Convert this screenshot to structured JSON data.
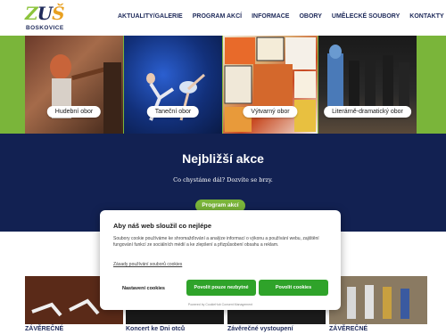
{
  "header": {
    "logo_text": "ZUŠ",
    "logo_city": "BOSKOVICE",
    "nav": [
      "AKTUALITY/GALERIE",
      "PROGRAM AKCÍ",
      "INFORMACE",
      "OBORY",
      "UMĚLECKÉ SOUBORY",
      "KONTAKTY"
    ]
  },
  "hero": {
    "tiles": [
      {
        "label": "Hudební obor"
      },
      {
        "label": "Taneční obor"
      },
      {
        "label": "Výtvarný obor"
      },
      {
        "label": "Literárně-dramatický obor"
      }
    ]
  },
  "events": {
    "title": "Nejbližší akce",
    "subtitle": "Co chystáme dál? Dozvíte se brzy.",
    "button": "Program akcí"
  },
  "cards": [
    {
      "title": "ZÁVĚREČNÉ"
    },
    {
      "title": "Koncert ke Dni otců"
    },
    {
      "title": "Závěrečné vystoupení"
    },
    {
      "title": "ZÁVĚREČNÉ"
    }
  ],
  "cookie": {
    "title": "Aby náš web sloužil co nejlépe",
    "body": "Soubory cookie používáme ke shromažďování a analýze informací o výkonu a používání webu, zajištění fungování funkcí ze sociálních médií a ke zlepšení a přizpůsobení obsahu a reklam.",
    "link": "Zásady používání souborů cookies",
    "settings_button": "Nastavení cookies",
    "necessary_button": "Povolit pouze nezbytné",
    "allow_button": "Povolit cookies",
    "powered": "Powered by CookieHub Consent Management"
  },
  "colors": {
    "navy": "#122152",
    "green": "#7ab53a",
    "button_green": "#2fa32a"
  }
}
